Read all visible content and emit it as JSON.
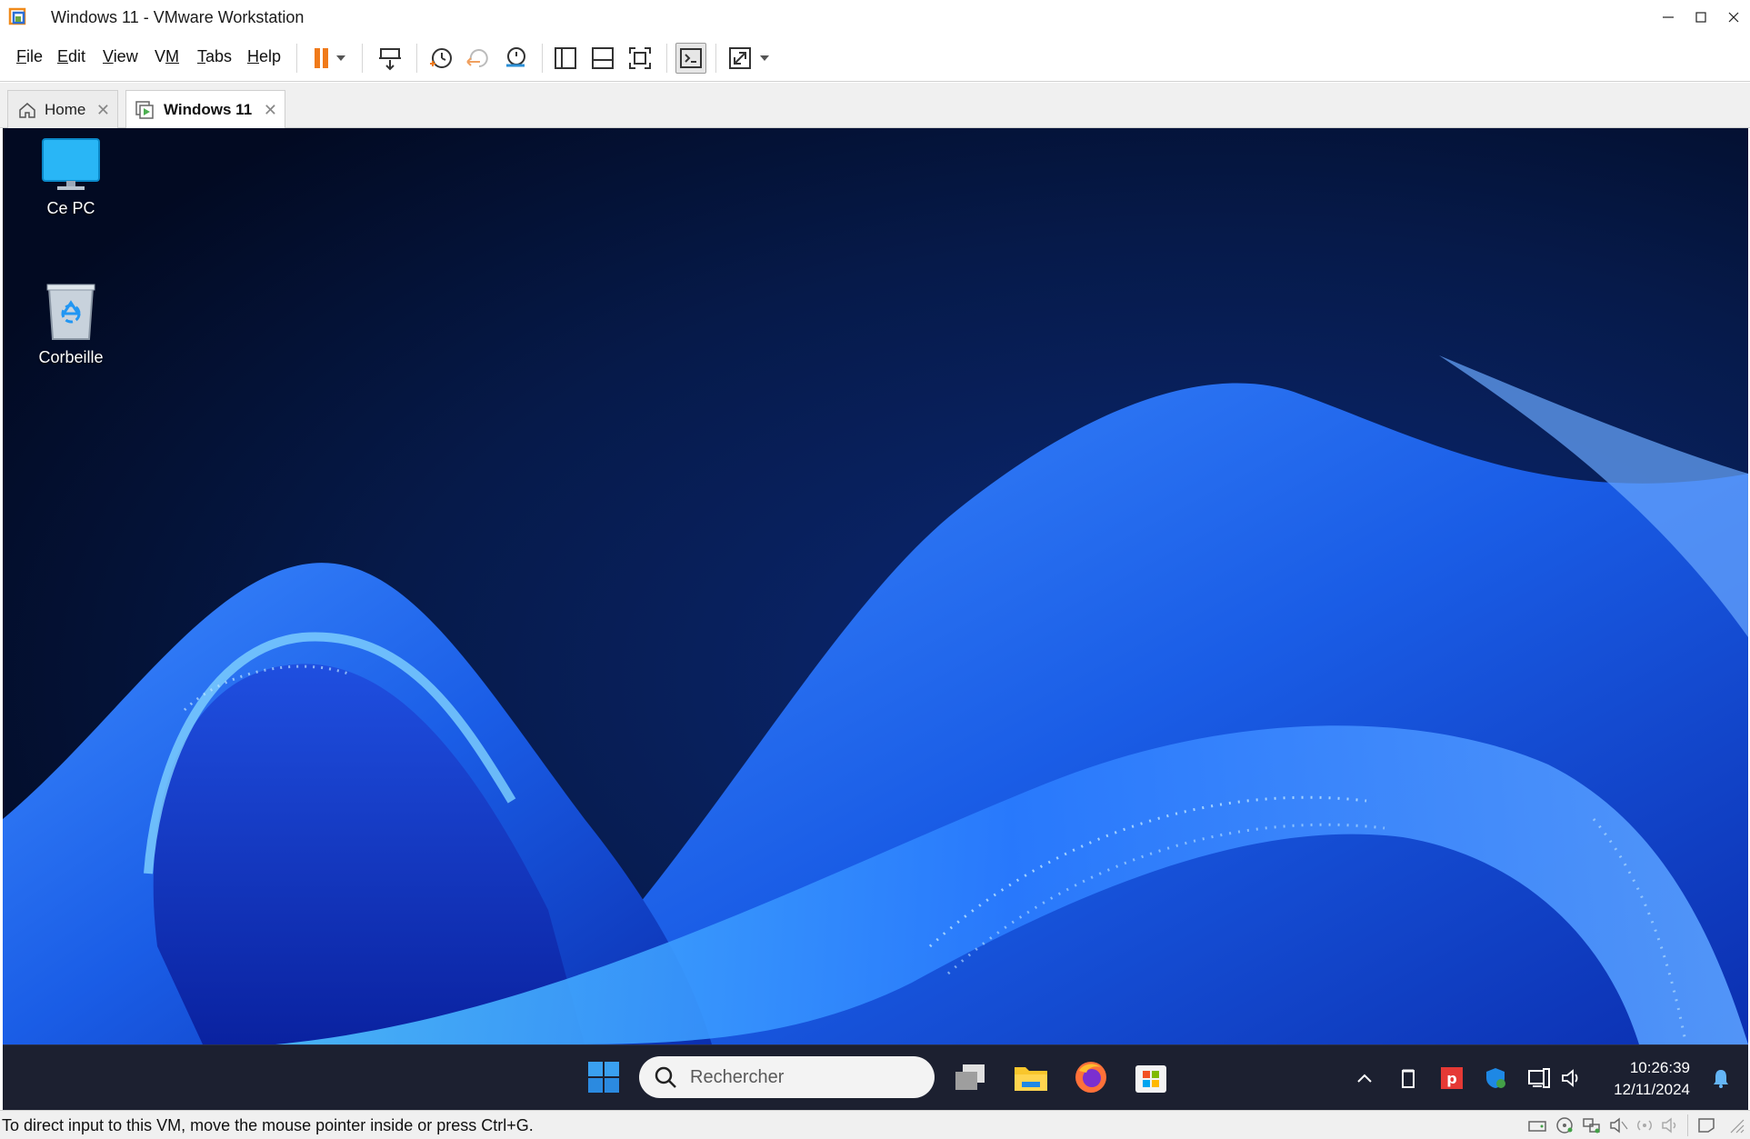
{
  "window": {
    "title": "Windows 11 - VMware Workstation"
  },
  "menu": {
    "items": [
      {
        "label_prefix": "",
        "accel": "F",
        "label_rest": "ile"
      },
      {
        "label_prefix": "",
        "accel": "E",
        "label_rest": "dit"
      },
      {
        "label_prefix": "",
        "accel": "V",
        "label_rest": "iew"
      },
      {
        "label_prefix": "V",
        "accel": "M",
        "label_rest": ""
      },
      {
        "label_prefix": "",
        "accel": "T",
        "label_rest": "abs"
      },
      {
        "label_prefix": "",
        "accel": "H",
        "label_rest": "elp"
      }
    ]
  },
  "toolbar": {
    "buttons": [
      "pause-icon",
      "send-ctrl-alt-del-icon",
      "snapshot-icon",
      "revert-snapshot-icon",
      "snapshot-manager-icon",
      "show-library-icon",
      "thumbnail-bar-icon",
      "full-screen-icon",
      "console-view-icon",
      "stretch-guest-icon"
    ]
  },
  "tabs": [
    {
      "label": "Home",
      "icon": "home-icon"
    },
    {
      "label": "Windows 11",
      "icon": "vm-icon"
    }
  ],
  "desktop": {
    "icons": [
      {
        "label": "Ce PC",
        "icon": "monitor-icon"
      },
      {
        "label": "Corbeille",
        "icon": "recycle-bin-icon"
      }
    ]
  },
  "taskbar": {
    "search_placeholder": "Rechercher",
    "apps": [
      "start-icon",
      "task-view-icon",
      "file-explorer-icon",
      "firefox-icon",
      "microsoft-store-icon"
    ],
    "time": "10:26:39",
    "date": "12/11/2024"
  },
  "statusbar": {
    "message": "To direct input to this VM, move the mouse pointer inside or press Ctrl+G."
  },
  "colors": {
    "accent_blue": "#1f6ff2",
    "pause_orange": "#f07a1a",
    "taskbar_bg": "#1c2030"
  }
}
